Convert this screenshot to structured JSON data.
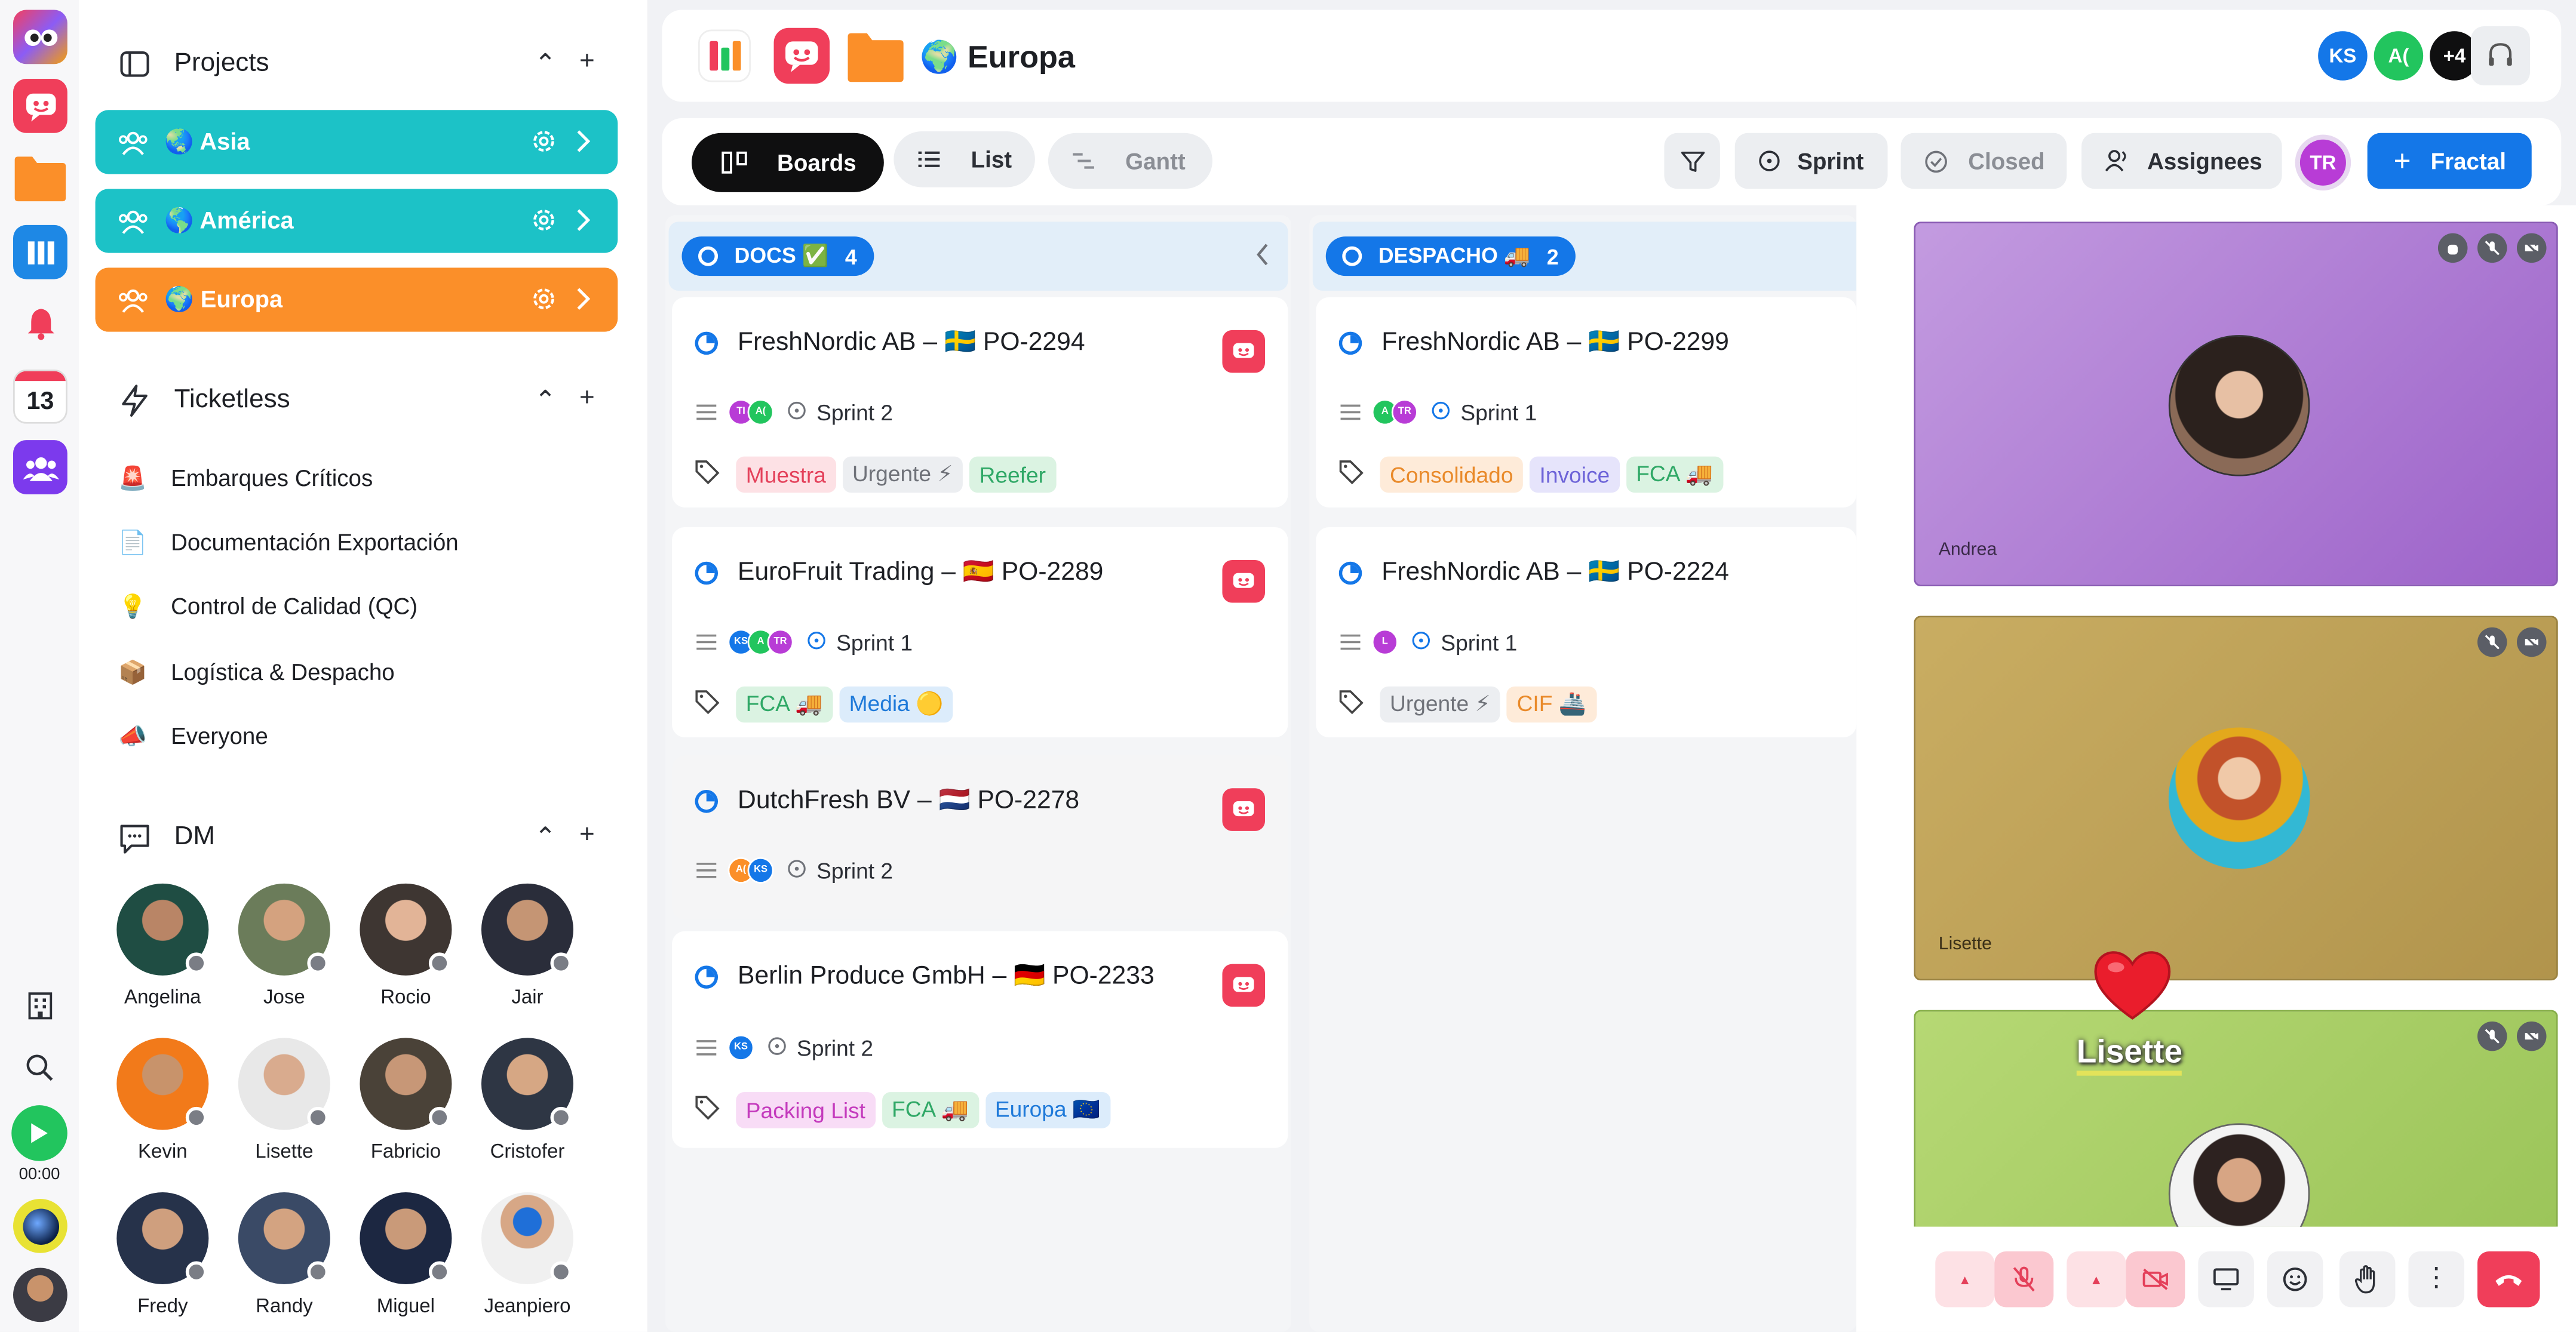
{
  "colors": {
    "teal": "#1cc2c7",
    "orange": "#fb8f29",
    "blue": "#1477e8",
    "red": "#f03e5a"
  },
  "rail": {
    "calendar_day": "13",
    "timer": "00:00"
  },
  "sidebar": {
    "projects_title": "Projects",
    "projects": [
      {
        "label": "🌏 Asia"
      },
      {
        "label": "🌎 América"
      },
      {
        "label": "🌍 Europa"
      }
    ],
    "ticketless_title": "Ticketless",
    "ticketless": [
      {
        "icon": "🚨",
        "label": "Embarques Críticos"
      },
      {
        "icon": "📄",
        "label": "Documentación Exportación"
      },
      {
        "icon": "💡",
        "label": "Control de Calidad (QC)"
      },
      {
        "icon": "📦",
        "label": "Logística & Despacho"
      },
      {
        "icon": "📣",
        "label": "Everyone"
      }
    ],
    "dm_title": "DM",
    "dms": [
      "Angelina",
      "Jose",
      "Rocio",
      "Jair",
      "Kevin",
      "Lisette",
      "Fabricio",
      "Cristofer",
      "Fredy",
      "Randy",
      "Miguel",
      "Jeanpiero"
    ]
  },
  "header": {
    "title": "🌍 Europa",
    "avatars": [
      "KS",
      "A(",
      "+4"
    ]
  },
  "toolbar": {
    "boards": "Boards",
    "list": "List",
    "gantt": "Gantt",
    "sprint": "Sprint",
    "closed": "Closed",
    "assignees": "Assignees",
    "me": "TR",
    "create": "Fractal"
  },
  "columns": [
    {
      "name": "DOCS ✅",
      "count": "4",
      "cards": [
        {
          "title": "FreshNordic AB – 🇸🇪 PO-2294",
          "avatars": [
            "TI",
            "A("
          ],
          "sprint": "Sprint 2",
          "tags": [
            "Muestra",
            "Urgente ⚡",
            "Reefer"
          ]
        },
        {
          "title": "EuroFruit Trading – 🇪🇸 PO-2289",
          "avatars": [
            "KS",
            "A",
            "TR"
          ],
          "sprint": "Sprint 1",
          "tags": [
            "FCA 🚚",
            "Media 🟡"
          ]
        },
        {
          "title": "DutchFresh BV – 🇳🇱 PO-2278",
          "avatars": [
            "A(",
            "KS"
          ],
          "sprint": "Sprint 2",
          "tags": []
        },
        {
          "title": "Berlin Produce GmbH – 🇩🇪 PO-2233",
          "avatars": [
            "KS"
          ],
          "sprint": "Sprint 2",
          "tags": [
            "Packing List",
            "FCA 🚚",
            "Europa 🇪🇺"
          ]
        }
      ]
    },
    {
      "name": "DESPACHO 🚚",
      "count": "2",
      "cards": [
        {
          "title": "FreshNordic AB – 🇸🇪 PO-2299",
          "avatars": [
            "A",
            "TR"
          ],
          "sprint": "Sprint 1",
          "tags": [
            "Consolidado",
            "Invoice",
            "FCA 🚚"
          ]
        },
        {
          "title": "FreshNordic AB – 🇸🇪 PO-2224",
          "avatars": [
            "L"
          ],
          "sprint": "Sprint 1",
          "tags": [
            "Urgente ⚡",
            "CIF 🚢"
          ]
        }
      ]
    }
  ],
  "video": {
    "tiles": [
      {
        "name": "Andrea"
      },
      {
        "name": "Lisette"
      },
      {
        "name": "Lisette"
      }
    ]
  }
}
